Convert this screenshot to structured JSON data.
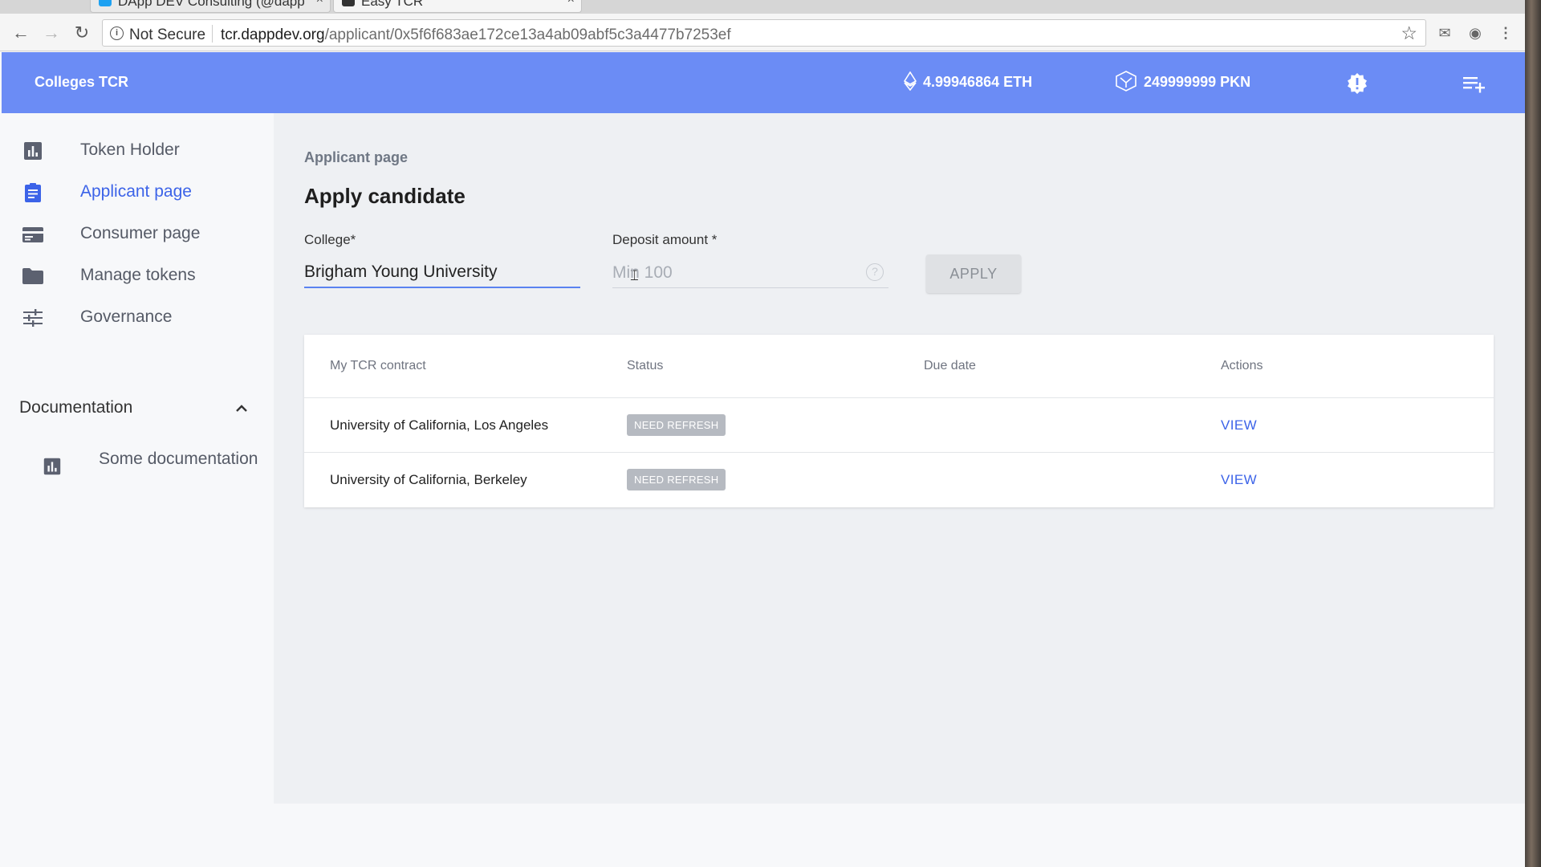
{
  "browser": {
    "tabs": [
      {
        "title": "DApp DEV Consulting (@dapp"
      },
      {
        "title": "Easy TCR"
      }
    ],
    "security_label": "Not Secure",
    "url_host": "tcr.dappdev.org",
    "url_path": "/applicant/0x5f6f683ae172ce13a4ab09abf5c3a4477b7253ef"
  },
  "header": {
    "app_title": "Colleges TCR",
    "eth_balance": "4.99946864 ETH",
    "pkn_balance": "249999999 PKN"
  },
  "sidebar": {
    "items": [
      {
        "label": "Token Holder",
        "icon": "bar-chart-icon"
      },
      {
        "label": "Applicant page",
        "icon": "clipboard-icon",
        "active": true
      },
      {
        "label": "Consumer page",
        "icon": "card-icon"
      },
      {
        "label": "Manage tokens",
        "icon": "folder-icon"
      },
      {
        "label": "Governance",
        "icon": "sliders-icon"
      }
    ],
    "documentation": {
      "label": "Documentation",
      "expanded": true,
      "items": [
        {
          "label": "Some documentation",
          "icon": "bar-chart-icon"
        }
      ]
    }
  },
  "main": {
    "breadcrumb": "Applicant page",
    "title": "Apply candidate",
    "form": {
      "college_label": "College*",
      "college_value": "Brigham Young University",
      "deposit_label": "Deposit amount *",
      "deposit_placeholder": "Min 100",
      "apply_label": "APPLY"
    },
    "table": {
      "columns": [
        "My TCR contract",
        "Status",
        "Due date",
        "Actions"
      ],
      "rows": [
        {
          "contract": "University of California, Los Angeles",
          "status": "NEED REFRESH",
          "due_date": "",
          "action": "VIEW"
        },
        {
          "contract": "University of California, Berkeley",
          "status": "NEED REFRESH",
          "due_date": "",
          "action": "VIEW"
        }
      ]
    }
  },
  "colors": {
    "header_bg": "#6b8cf5",
    "accent": "#3c63e8",
    "badge": "#b6bac1"
  }
}
